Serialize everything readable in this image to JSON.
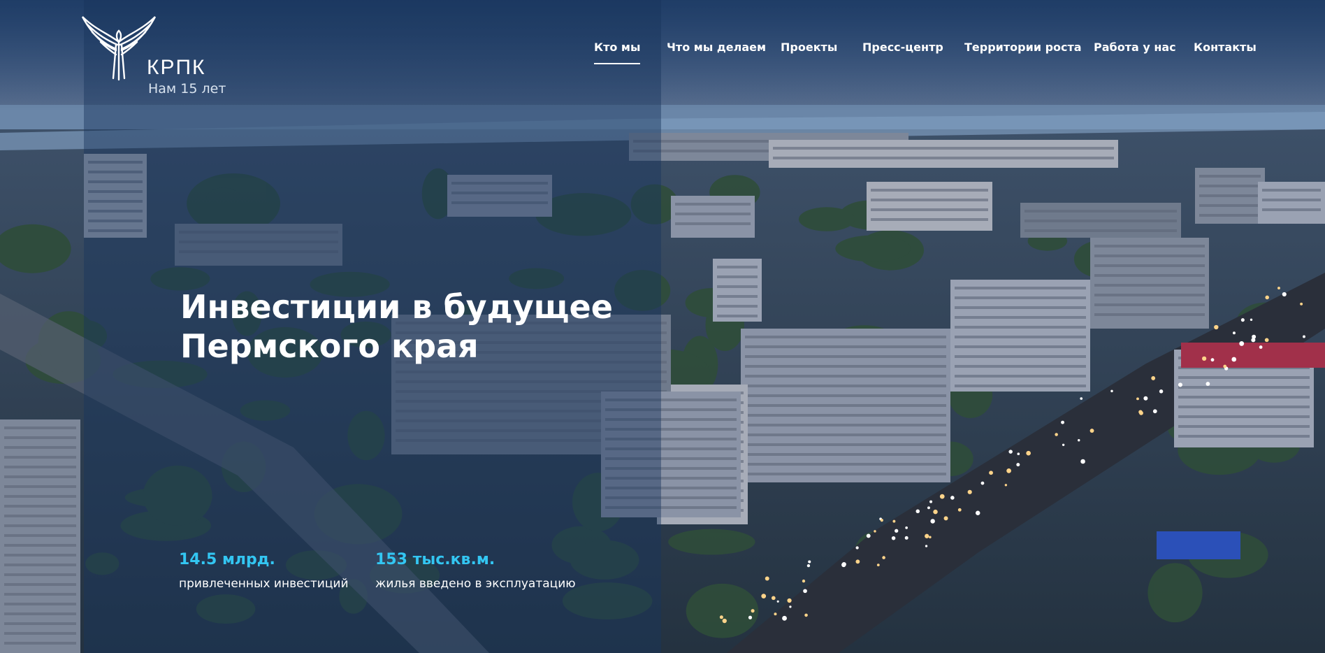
{
  "brand": {
    "name": "КРПК",
    "tagline": "Нам 15 лет",
    "logo_icon": "bird-wings-icon"
  },
  "nav": {
    "items": [
      {
        "label": "Кто мы",
        "active": true
      },
      {
        "label": "Что мы делаем",
        "active": false
      },
      {
        "label": "Проекты",
        "active": false
      },
      {
        "label": "Пресс-центр",
        "active": false
      },
      {
        "label": "Территории роста",
        "active": false
      },
      {
        "label": "Работа у нас",
        "active": false
      },
      {
        "label": "Контакты",
        "active": false
      }
    ]
  },
  "hero": {
    "headline_line1": "Инвестиции в будущее",
    "headline_line2": "Пермского края",
    "background": "aerial-city-evening-photo"
  },
  "stats": [
    {
      "value": "14.5 млрд.",
      "label": "привлеченных инвестиций"
    },
    {
      "value": "153 тыс.кв.м.",
      "label": "жилья введено в эксплуатацию"
    }
  ],
  "colors": {
    "accent": "#33c6f2",
    "overlay": "#18365e",
    "text": "#ffffff"
  }
}
